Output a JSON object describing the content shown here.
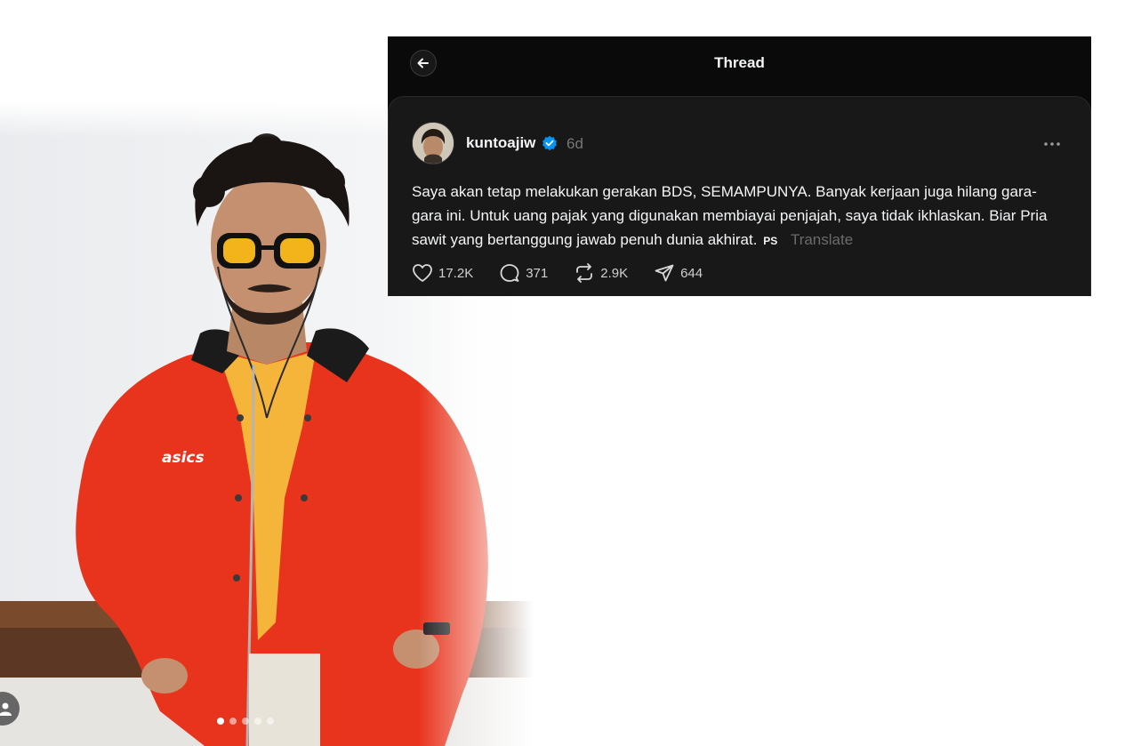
{
  "thread": {
    "title": "Thread",
    "post": {
      "username": "kuntoajiw",
      "time": "6d",
      "text": "Saya akan tetap melakukan gerakan BDS, SEMAMPUNYA. Banyak kerjaan juga hilang gara-gara ini. Untuk uang pajak yang digunakan membiayai penjajah, saya tidak ikhlaskan. Biar Pria sawit yang bertanggung jawab penuh dunia akhirat.",
      "lang_tag": "PS",
      "translate_label": "Translate",
      "likes": "17.2K",
      "replies": "371",
      "reposts": "2.9K",
      "shares": "644"
    }
  },
  "colors": {
    "panel_bg": "#0a0a0a",
    "post_bg": "#181818",
    "verified_blue": "#0095f6",
    "jacket_red": "#e8341c",
    "shirt_yellow": "#f5b43a"
  },
  "photo": {
    "brand_text": "asics",
    "carousel_dots": 5,
    "active_dot": 1
  },
  "icons": [
    "back-arrow-icon",
    "verified-badge-icon",
    "more-icon",
    "heart-icon",
    "comment-icon",
    "repost-icon",
    "share-icon",
    "user-icon"
  ]
}
